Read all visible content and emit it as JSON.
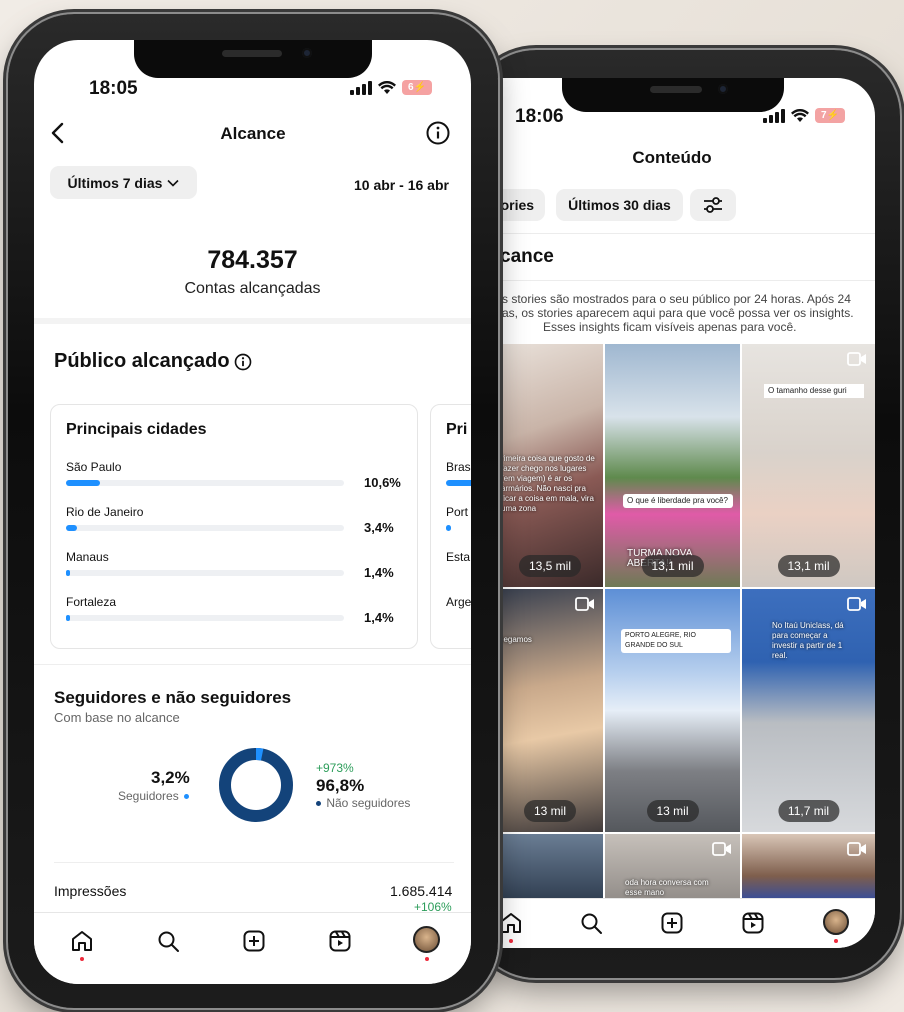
{
  "left": {
    "status_time": "18:05",
    "battery": "6⚡",
    "title": "Alcance",
    "period_chip": "Últimos 7 dias",
    "date_range": "10 abr - 16 abr",
    "accounts_reached_value": "784.357",
    "accounts_reached_label": "Contas alcançadas",
    "audience_title": "Público alcançado",
    "cities_card": {
      "title": "Principais cidades",
      "rows": [
        {
          "name": "São Paulo",
          "pct": "10,6%",
          "value": 10.6
        },
        {
          "name": "Rio de Janeiro",
          "pct": "3,4%",
          "value": 3.4
        },
        {
          "name": "Manaus",
          "pct": "1,4%",
          "value": 1.4
        },
        {
          "name": "Fortaleza",
          "pct": "1,4%",
          "value": 1.4
        }
      ]
    },
    "countries_card": {
      "title": "Pri",
      "rows": [
        "Bras",
        "Port",
        "Esta",
        "Arge"
      ]
    },
    "followers": {
      "title": "Seguidores e não seguidores",
      "subtitle": "Com base no alcance",
      "followers_pct": "3,2%",
      "followers_label": "Seguidores",
      "followers_value": 3.2,
      "growth": "+973%",
      "non_followers_pct": "96,8%",
      "non_followers_label": "Não seguidores",
      "follower_color": "#1e90ff",
      "non_follower_color": "#13437a"
    },
    "impressions_label": "Impressões",
    "impressions_value": "1.685.414",
    "impressions_growth": "+106%",
    "nav": [
      "home-icon",
      "search-icon",
      "create-icon",
      "reels-icon",
      "profile-icon"
    ]
  },
  "right": {
    "status_time": "18:06",
    "battery": "7⚡",
    "title": "Conteúdo",
    "chips": [
      "tories",
      "Últimos 30 dias"
    ],
    "section_title": "cance",
    "info_text_1": "s stories são mostrados para o seu público por 24 horas. Após 24",
    "info_text_2": "as, os stories aparecem aqui para que você possa ver os insights.",
    "info_text_3": "Esses insights ficam visíveis apenas para você.",
    "tiles": [
      {
        "reach": "13,5 mil",
        "caption": "rimeira coisa que gosto de fazer chego nos lugares (em viagem) é ar os armários. Não nasci pra ficar a coisa em mala, vira uma zona"
      },
      {
        "reach": "13,1 mil",
        "caption": "O que é liberdade pra você?",
        "caption2": "TURMA NOVA ABERTA!!"
      },
      {
        "reach": "13,1 mil",
        "caption": "O tamanho desse guri"
      },
      {
        "reach": "13 mil",
        "caption": "hegamos"
      },
      {
        "reach": "13 mil",
        "caption": "PORTO ALEGRE, RIO GRANDE DO SUL"
      },
      {
        "reach": "11,7 mil",
        "caption": "No Itaú Uniclass, dá para começar a investir a partir de 1 real."
      },
      {
        "reach": "",
        "caption": ""
      },
      {
        "reach": "",
        "caption": "oda hora conversa com esse mano"
      },
      {
        "reach": "",
        "caption": ""
      }
    ],
    "nav": [
      "home-icon",
      "search-icon",
      "create-icon",
      "reels-icon",
      "profile-icon"
    ]
  }
}
